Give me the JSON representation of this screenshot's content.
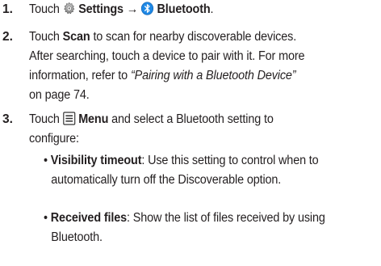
{
  "steps": [
    {
      "number": "1.",
      "touch": "Touch",
      "settings": "Settings",
      "arrow": "→",
      "bluetooth": "Bluetooth",
      "end": "."
    },
    {
      "number": "2.",
      "touch": "Touch",
      "scan": "Scan",
      "line1_rest": "to scan for nearby discoverable devices.",
      "line2": "After searching, touch a device to pair with it. For more",
      "line3_start": "information, refer to",
      "line3_link": "“Pairing with a Bluetooth Device”",
      "line4": "on page 74."
    },
    {
      "number": "3.",
      "touch": "Touch",
      "menu": "Menu",
      "line1_rest": "and select a Bluetooth setting to",
      "line2": "configure:"
    }
  ],
  "bullets": [
    {
      "term": "Visibility timeout",
      "line1_rest": ": Use this setting to control when to",
      "line2": "automatically turn off the Discoverable option."
    },
    {
      "term": "Received files",
      "line1_rest": ": Show the list of files received by using",
      "line2": "Bluetooth."
    }
  ],
  "icons": {
    "settings": "gear-icon",
    "bluetooth": "bluetooth-icon",
    "menu": "menu-icon"
  },
  "colors": {
    "text": "#231f20",
    "bluetooth_blue": "#1e88e5",
    "gear_gray": "#9e9e9e"
  }
}
